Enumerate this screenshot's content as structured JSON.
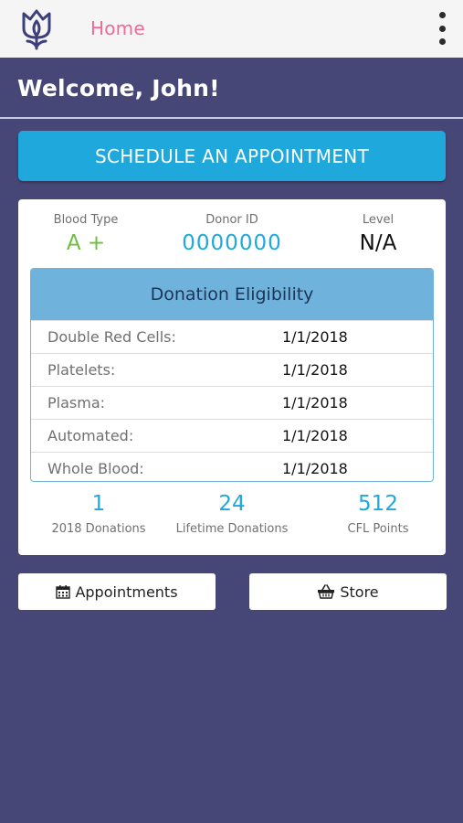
{
  "header": {
    "title": "Home",
    "logo_icon": "tulip-logo-icon",
    "menu_icon": "kebab-menu-icon"
  },
  "welcome": "Welcome, John!",
  "schedule_button": "SCHEDULE AN APPOINTMENT",
  "donor": {
    "blood_type_label": "Blood Type",
    "blood_type": "A +",
    "donor_id_label": "Donor ID",
    "donor_id": "0000000",
    "level_label": "Level",
    "level": "N/A"
  },
  "eligibility": {
    "title": "Donation Eligibility",
    "rows": [
      {
        "label": "Double Red Cells:",
        "date": "1/1/2018"
      },
      {
        "label": "Platelets:",
        "date": "1/1/2018"
      },
      {
        "label": "Plasma:",
        "date": "1/1/2018"
      },
      {
        "label": "Automated:",
        "date": "1/1/2018"
      },
      {
        "label": "Whole Blood:",
        "date": "1/1/2018"
      }
    ]
  },
  "counts": [
    {
      "value": "1",
      "label": "2018 Donations"
    },
    {
      "value": "24",
      "label": "Lifetime Donations"
    },
    {
      "value": "512",
      "label": "CFL Points"
    }
  ],
  "buttons": {
    "appointments": "Appointments",
    "appointments_icon": "calendar-icon",
    "store": "Store",
    "store_icon": "basket-icon"
  },
  "colors": {
    "background": "#464677",
    "accent": "#1ea8dc",
    "home_pink": "#ef6a9a",
    "blood_type_green": "#6cbf3c",
    "eligibility_header": "#6fb3dd"
  }
}
